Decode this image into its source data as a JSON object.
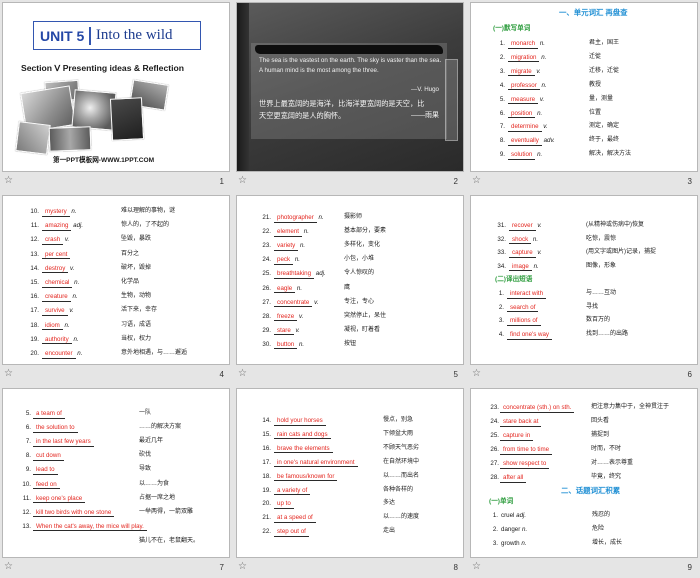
{
  "colors": {
    "answer-red": "#e3261f",
    "heading-blue": "#1f8fd4",
    "subheading-green": "#2f9d3f",
    "unit-blue": "#2447a6"
  },
  "footer_icon": "star-icon",
  "slides": [
    {
      "number": "1",
      "unit": "UNIT 5",
      "unit_title": "Into the wild",
      "section": "Section Ⅴ Presenting ideas & Reflection",
      "watermark": "第一PPT模板网-WWW.1PPT.COM"
    },
    {
      "number": "2",
      "quote_en": "The sea is the vastest on the earth. The sky is vaster than the sea. A human mind is the most among the three.",
      "quote_en_author": "—V. Hugo",
      "quote_zh": "世界上最宽阔的是海洋，比海洋更宽阔的是天空，比天空更宽阔的是人的胸怀。",
      "quote_zh_author": "——雨果"
    },
    {
      "number": "3",
      "heading": "一、单元词汇 再盘查",
      "subheading": "(一)默写单词",
      "items": [
        {
          "num": "1.",
          "word": "monarch",
          "pos": "n.",
          "meaning": "君主，国王"
        },
        {
          "num": "2.",
          "word": "migration",
          "pos": "n.",
          "meaning": "迁徙"
        },
        {
          "num": "3.",
          "word": "migrate",
          "pos": "v.",
          "meaning": "迁移，迁徙"
        },
        {
          "num": "4.",
          "word": "professor",
          "pos": "n.",
          "meaning": "教授"
        },
        {
          "num": "5.",
          "word": "measure",
          "pos": "v.",
          "meaning": "量，测量"
        },
        {
          "num": "6.",
          "word": "position",
          "pos": "n.",
          "meaning": "位置"
        },
        {
          "num": "7.",
          "word": "determine",
          "pos": "v.",
          "meaning": "测定，确定"
        },
        {
          "num": "8.",
          "word": "eventually",
          "pos": "adv.",
          "meaning": "终于，最终"
        },
        {
          "num": "9.",
          "word": "solution",
          "pos": "n.",
          "meaning": "解决，解决方法"
        }
      ]
    },
    {
      "number": "4",
      "items": [
        {
          "num": "10.",
          "word": "mystery",
          "pos": "n.",
          "meaning": "难以理解的事物，谜"
        },
        {
          "num": "11.",
          "word": "amazing",
          "pos": "adj.",
          "meaning": "惊人的，了不起的"
        },
        {
          "num": "12.",
          "word": "crash",
          "pos": "v.",
          "meaning": "坠毁，暴跌"
        },
        {
          "num": "13.",
          "word": "per cent",
          "meaning": "百分之"
        },
        {
          "num": "14.",
          "word": "destroy",
          "pos": "v.",
          "meaning": "破坏，毁掉"
        },
        {
          "num": "15.",
          "word": "chemical",
          "pos": "n.",
          "meaning": "化学品"
        },
        {
          "num": "16.",
          "word": "creature",
          "pos": "n.",
          "meaning": "生物，动物"
        },
        {
          "num": "17.",
          "word": "survive",
          "pos": "v.",
          "meaning": "活下来，幸存"
        },
        {
          "num": "18.",
          "word": "idiom",
          "pos": "n.",
          "meaning": "习语，成语"
        },
        {
          "num": "19.",
          "word": "authority",
          "pos": "n.",
          "meaning": "当权，权力"
        },
        {
          "num": "20.",
          "word": "encounter",
          "pos": "n.",
          "meaning": "意外地相遇，与……邂逅"
        }
      ]
    },
    {
      "number": "5",
      "items": [
        {
          "num": "21.",
          "word": "photographer",
          "pos": "n.",
          "meaning": "摄影师"
        },
        {
          "num": "22.",
          "word": "element",
          "pos": "n.",
          "meaning": "基本部分，要素"
        },
        {
          "num": "23.",
          "word": "variety",
          "pos": "n.",
          "meaning": "多样化，变化"
        },
        {
          "num": "24.",
          "word": "peck",
          "pos": "n.",
          "meaning": "小包，小堆"
        },
        {
          "num": "25.",
          "word": "breathtaking",
          "pos": "adj.",
          "meaning": "令人惊叹的"
        },
        {
          "num": "26.",
          "word": "eagle",
          "pos": "n.",
          "meaning": "鹰"
        },
        {
          "num": "27.",
          "word": "concentrate",
          "pos": "v.",
          "meaning": "专注，专心"
        },
        {
          "num": "28.",
          "word": "freeze",
          "pos": "v.",
          "meaning": "突然停止，呆住"
        },
        {
          "num": "29.",
          "word": "stare",
          "pos": "v.",
          "meaning": "凝视，盯着看"
        },
        {
          "num": "30.",
          "word": "button",
          "pos": "n.",
          "meaning": "按钮"
        }
      ]
    },
    {
      "number": "6",
      "items": [
        {
          "num": "31.",
          "word": "recover",
          "pos": "v.",
          "meaning": "(从精神或伤病中)恢复"
        },
        {
          "num": "32.",
          "word": "shock",
          "pos": "n.",
          "meaning": "吃惊，震惊"
        },
        {
          "num": "33.",
          "word": "capture",
          "pos": "v.",
          "meaning": "(用文字或图片)记录，捕捉"
        },
        {
          "num": "34.",
          "word": "image",
          "pos": "n.",
          "meaning": "图像，形象"
        }
      ],
      "subheading": "(二)译出短语",
      "phrases": [
        {
          "num": "1.",
          "word": "interact with",
          "meaning": "与……互动"
        },
        {
          "num": "2.",
          "word": "search of",
          "meaning": "寻找"
        },
        {
          "num": "3.",
          "word": "millions of",
          "meaning": "数百万的"
        },
        {
          "num": "4.",
          "word": "find one's way",
          "meaning": "找到……的出路"
        }
      ]
    },
    {
      "number": "7",
      "phrases": [
        {
          "num": "5.",
          "word": "a team of",
          "meaning": "一队"
        },
        {
          "num": "6.",
          "word": "the solution to",
          "meaning": "……的解决方案"
        },
        {
          "num": "7.",
          "word": "in the last few years",
          "meaning": "最近几年"
        },
        {
          "num": "8.",
          "word": "cut down",
          "meaning": "砍伐"
        },
        {
          "num": "9.",
          "word": "lead to",
          "meaning": "导致"
        },
        {
          "num": "10.",
          "word": "feed on",
          "meaning": "以……为食"
        },
        {
          "num": "11.",
          "word": "keep one's place",
          "meaning": "占据一席之地"
        },
        {
          "num": "12.",
          "word": "kill two birds with one stone",
          "meaning": "一举两得，一箭双雕"
        },
        {
          "num": "13.",
          "word": "When the cat's away, the mice will play.",
          "meaning": "猫儿不在，老鼠翻天。"
        }
      ]
    },
    {
      "number": "8",
      "phrases": [
        {
          "num": "14.",
          "word": "hold your horses",
          "meaning": "慢点，别急"
        },
        {
          "num": "15.",
          "word": "rain cats and dogs",
          "meaning": "下倾盆大雨"
        },
        {
          "num": "16.",
          "word": "brave the elements",
          "meaning": "不顾天气恶劣"
        },
        {
          "num": "17.",
          "word": "in one's natural environment",
          "meaning": "在自然环境中"
        },
        {
          "num": "18.",
          "word": "be famous/known for",
          "meaning": "以……而出名"
        },
        {
          "num": "19.",
          "word": "a variety of",
          "meaning": "各种各样的"
        },
        {
          "num": "20.",
          "word": "up to",
          "meaning": "多达"
        },
        {
          "num": "21.",
          "word": "at a speed of",
          "meaning": "以……的速度"
        },
        {
          "num": "22.",
          "word": "step out of",
          "meaning": "走出"
        }
      ]
    },
    {
      "number": "9",
      "phrases": [
        {
          "num": "23.",
          "word": "concentrate (sth.) on sth.",
          "meaning": "把注意力集中于，全神贯注于"
        },
        {
          "num": "24.",
          "word": "stare back at",
          "meaning": "回头看"
        },
        {
          "num": "25.",
          "word": "capture in",
          "meaning": "捕捉到"
        },
        {
          "num": "26.",
          "word": "from time to time",
          "meaning": "时而，不时"
        },
        {
          "num": "27.",
          "word": "show respect to",
          "meaning": "对……表示尊重"
        },
        {
          "num": "28.",
          "word": "after all",
          "meaning": "毕竟，终究"
        }
      ],
      "heading": "二、话题词汇积累",
      "subheading": "(一)单词",
      "items": [
        {
          "num": "1.",
          "word": "cruel",
          "pos": "adj.",
          "meaning": "残忍的"
        },
        {
          "num": "2.",
          "word": "danger",
          "pos": "n.",
          "meaning": "危险"
        },
        {
          "num": "3.",
          "word": "growth",
          "pos": "n.",
          "meaning": "增长，成长"
        }
      ]
    }
  ]
}
